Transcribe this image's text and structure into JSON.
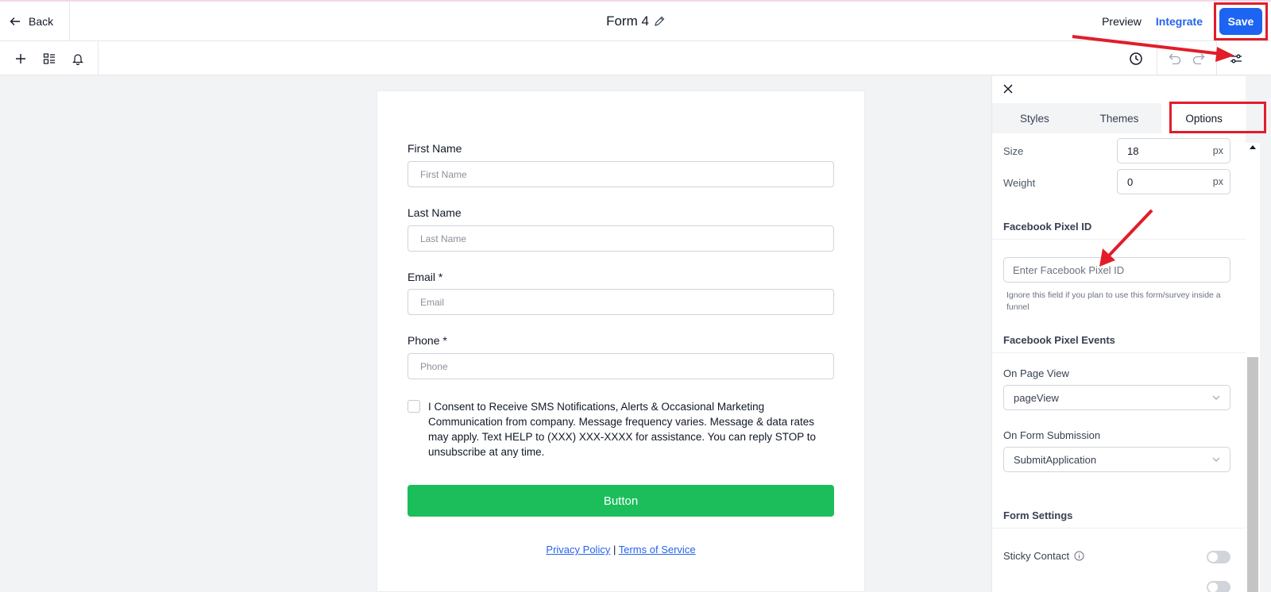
{
  "header": {
    "back_label": "Back",
    "form_title": "Form 4",
    "preview_label": "Preview",
    "integrate_label": "Integrate",
    "save_label": "Save"
  },
  "icons": {
    "toolbar_left": [
      "plus-icon",
      "layout-icon",
      "bell-icon"
    ],
    "toolbar_right": [
      "history-icon",
      "undo-icon",
      "redo-icon",
      "settings-icon"
    ]
  },
  "form": {
    "fields": [
      {
        "label": "First Name",
        "placeholder": "First Name"
      },
      {
        "label": "Last Name",
        "placeholder": "Last Name"
      },
      {
        "label": "Email *",
        "placeholder": "Email"
      },
      {
        "label": "Phone *",
        "placeholder": "Phone"
      }
    ],
    "consent_text": "I Consent to Receive SMS Notifications, Alerts & Occasional Marketing Communication from company. Message frequency varies. Message & data rates may apply. Text HELP to (XXX) XXX-XXXX for assistance. You can reply STOP to unsubscribe at any time.",
    "button_label": "Button",
    "privacy_label": "Privacy Policy",
    "separator": "|",
    "terms_label": "Terms of Service"
  },
  "panel": {
    "tabs": [
      "Styles",
      "Themes",
      "Options"
    ],
    "active_tab": "Options",
    "size_label": "Size",
    "size_value": "18",
    "weight_label": "Weight",
    "weight_value": "0",
    "unit": "px",
    "pixel_section": "Facebook Pixel ID",
    "pixel_placeholder": "Enter Facebook Pixel ID",
    "pixel_hint": "Ignore this field if you plan to use this form/survey inside a funnel",
    "events_section": "Facebook Pixel Events",
    "page_view_label": "On Page View",
    "page_view_value": "pageView",
    "submission_label": "On Form Submission",
    "submission_value": "SubmitApplication",
    "settings_section": "Form Settings",
    "sticky_label": "Sticky Contact"
  },
  "colors": {
    "save": "#1d64f2",
    "submit": "#1bbe5b",
    "annotation": "#e11d2a",
    "link": "#2563eb"
  }
}
